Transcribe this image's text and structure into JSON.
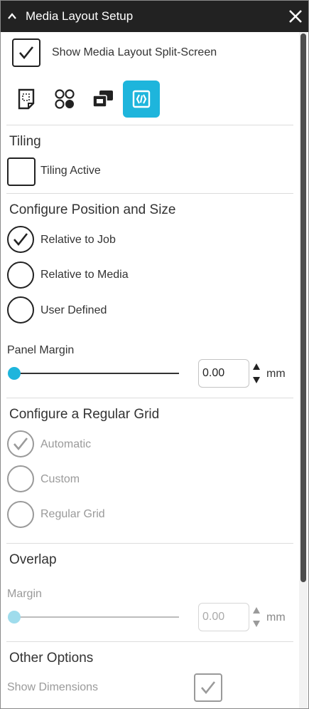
{
  "window": {
    "title": "Media Layout Setup"
  },
  "show_split_screen": {
    "label": "Show Media Layout Split-Screen",
    "checked": true
  },
  "toolbar": {
    "icons": [
      {
        "name": "page-layout-icon",
        "active": false
      },
      {
        "name": "grid-dots-icon",
        "active": false
      },
      {
        "name": "panels-icon",
        "active": false
      },
      {
        "name": "tiling-icon",
        "active": true
      }
    ]
  },
  "tiling": {
    "heading": "Tiling",
    "active_label": "Tiling Active",
    "active_checked": false
  },
  "position": {
    "heading": "Configure Position and Size",
    "options": [
      {
        "label": "Relative to Job",
        "selected": true
      },
      {
        "label": "Relative to Media",
        "selected": false
      },
      {
        "label": "User Defined",
        "selected": false
      }
    ],
    "panel_margin": {
      "label": "Panel Margin",
      "value": "0.00",
      "unit": "mm",
      "slider_fraction": 0
    }
  },
  "grid": {
    "heading": "Configure a Regular Grid",
    "options": [
      {
        "label": "Automatic",
        "selected": true
      },
      {
        "label": "Custom",
        "selected": false
      },
      {
        "label": "Regular Grid",
        "selected": false
      }
    ]
  },
  "overlap": {
    "heading": "Overlap",
    "margin": {
      "label": "Margin",
      "value": "0.00",
      "unit": "mm",
      "slider_fraction": 0
    }
  },
  "other": {
    "heading": "Other Options",
    "show_dimensions_label": "Show Dimensions",
    "show_dimensions_checked": true
  },
  "colors": {
    "accent": "#1eb5dc",
    "titlebar": "#222222"
  }
}
